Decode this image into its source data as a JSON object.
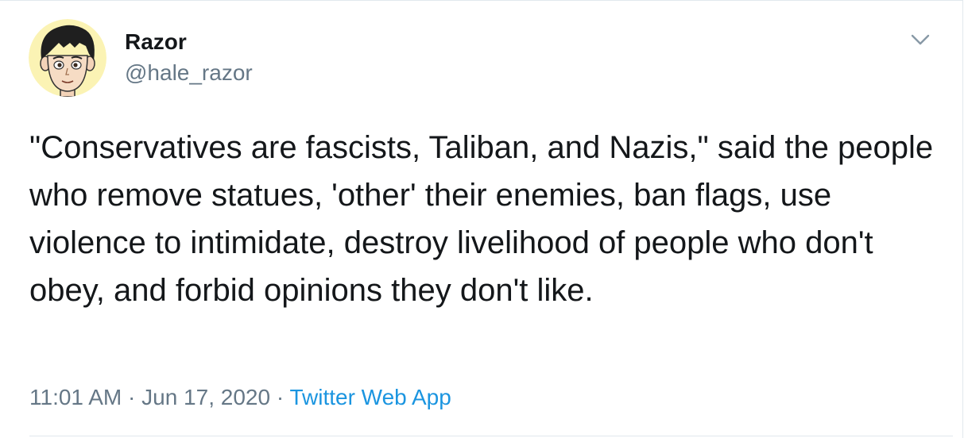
{
  "tweet": {
    "display_name": "Razor",
    "handle": "@hale_razor",
    "text": "\"Conservatives are fascists, Taliban, and Nazis,\" said the people who remove statues, 'other' their enemies, ban flags, use violence to intimidate, destroy livelihood of people who don't obey, and forbid opinions they don't like.",
    "time": "11:01 AM",
    "separator": " · ",
    "date": "Jun 17, 2020",
    "source": "Twitter Web App"
  },
  "icons": {
    "avatar": "cartoon-avatar",
    "menu": "chevron-down-icon"
  },
  "colors": {
    "name": "#14171a",
    "secondary_text": "#657786",
    "link": "#1b95e0",
    "avatar_background": "#fbf3b4",
    "border": "#e1e8ed"
  }
}
